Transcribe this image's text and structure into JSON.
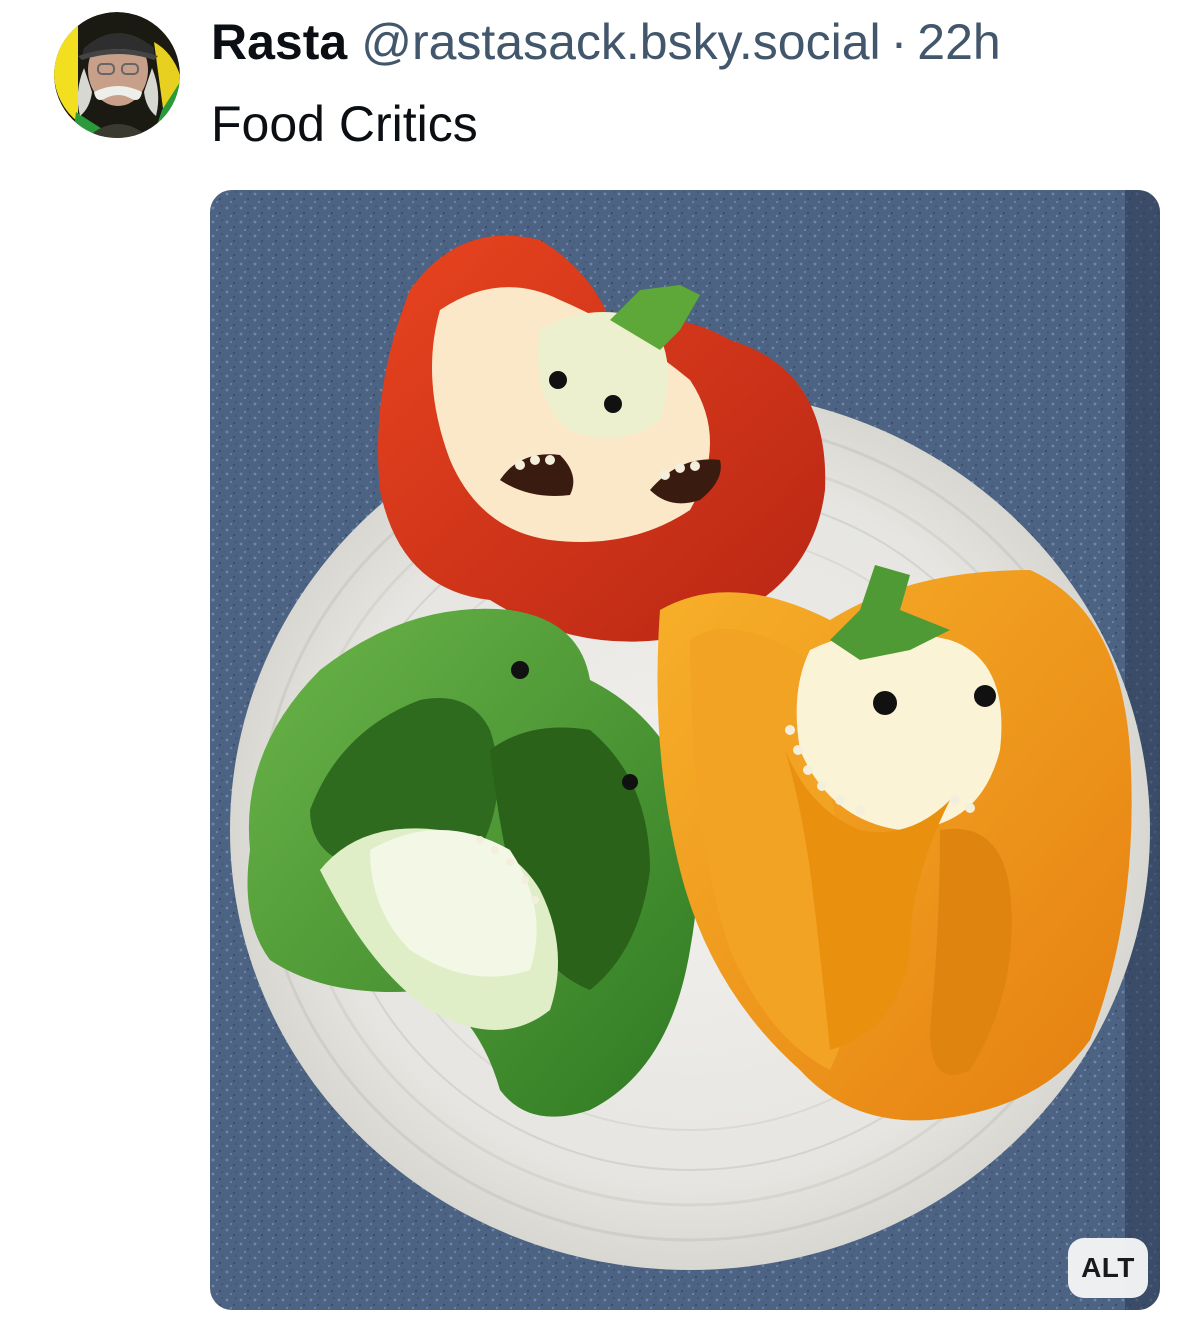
{
  "post": {
    "author_name": "Rasta",
    "author_handle": "@rastasack.bsky.social",
    "separator": "·",
    "time_ago": "22h",
    "text": "Food Critics",
    "media": {
      "alt_badge": "ALT",
      "icon": "photo-three-bell-peppers-with-faces"
    }
  },
  "colors": {
    "name": "#0b0f14",
    "handle": "#42576c",
    "text": "#0b0f14",
    "countertop": "#4a6080",
    "plate": "#ededea",
    "pepper_red": "#d23a1e",
    "pepper_green": "#4f9a34",
    "pepper_orange": "#f39a1a"
  }
}
